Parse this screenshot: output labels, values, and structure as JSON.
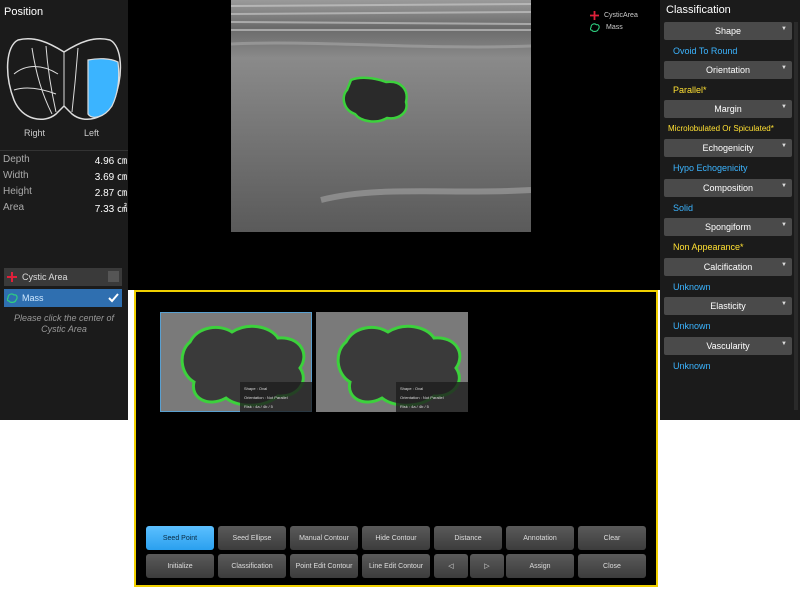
{
  "position": {
    "title": "Position",
    "right_label": "Right",
    "left_label": "Left",
    "highlight_color": "#3bb4ff"
  },
  "measurements": [
    {
      "label": "Depth",
      "value": "4.96 ㎝"
    },
    {
      "label": "Width",
      "value": "3.69 ㎝"
    },
    {
      "label": "Height",
      "value": "2.87 ㎝"
    },
    {
      "label": "Area",
      "value": "7.33 ㎠"
    }
  ],
  "segment_list": [
    {
      "label": "Cystic Area",
      "icon": "cystic-area-icon",
      "selected": false
    },
    {
      "label": "Mass",
      "icon": "mass-icon",
      "selected": true
    }
  ],
  "hint": "Please click the center of Cystic Area",
  "legend": [
    {
      "label": "CysticArea",
      "icon": "cystic-area-icon",
      "color": "#e0203a"
    },
    {
      "label": "Mass",
      "icon": "mass-icon",
      "color": "#2fd080"
    }
  ],
  "classification": {
    "title": "Classification",
    "items": [
      {
        "name": "Shape",
        "value": "Ovoid To Round",
        "color": "#3bb4ff"
      },
      {
        "name": "Orientation",
        "value": "Parallel*",
        "color": "#ffe033"
      },
      {
        "name": "Margin",
        "value": "Microlobulated Or Spiculated*",
        "color": "#ffe033"
      },
      {
        "name": "Echogenicity",
        "value": "Hypo Echogenicity",
        "color": "#3bb4ff"
      },
      {
        "name": "Composition",
        "value": "Solid",
        "color": "#3bb4ff"
      },
      {
        "name": "Spongiform",
        "value": "Non Appearance*",
        "color": "#ffe033"
      },
      {
        "name": "Calcification",
        "value": "Unknown",
        "color": "#3bb4ff"
      },
      {
        "name": "Elasticity",
        "value": "Unknown",
        "color": "#3bb4ff"
      },
      {
        "name": "Vascularity",
        "value": "Unknown",
        "color": "#3bb4ff"
      }
    ]
  },
  "thumbnails": [
    {
      "lines": [
        "Shape : Oval",
        "Orientation : Not Parallel",
        "Risk : 4a / 4b / 5"
      ]
    },
    {
      "lines": [
        "Shape : Oval",
        "Orientation : Not Parallel",
        "Risk : 4a / 4b / 5"
      ]
    }
  ],
  "toolbar": {
    "row1": [
      "Seed Point",
      "Seed Ellipse",
      "Manual Contour",
      "Hide Contour",
      "Distance",
      "Annotation",
      "Clear"
    ],
    "row2": [
      "Initialize",
      "Classification",
      "Point Edit Contour",
      "Line Edit Contour",
      "◁",
      "▷",
      "Assign",
      "Close"
    ],
    "active": "Seed Point"
  }
}
